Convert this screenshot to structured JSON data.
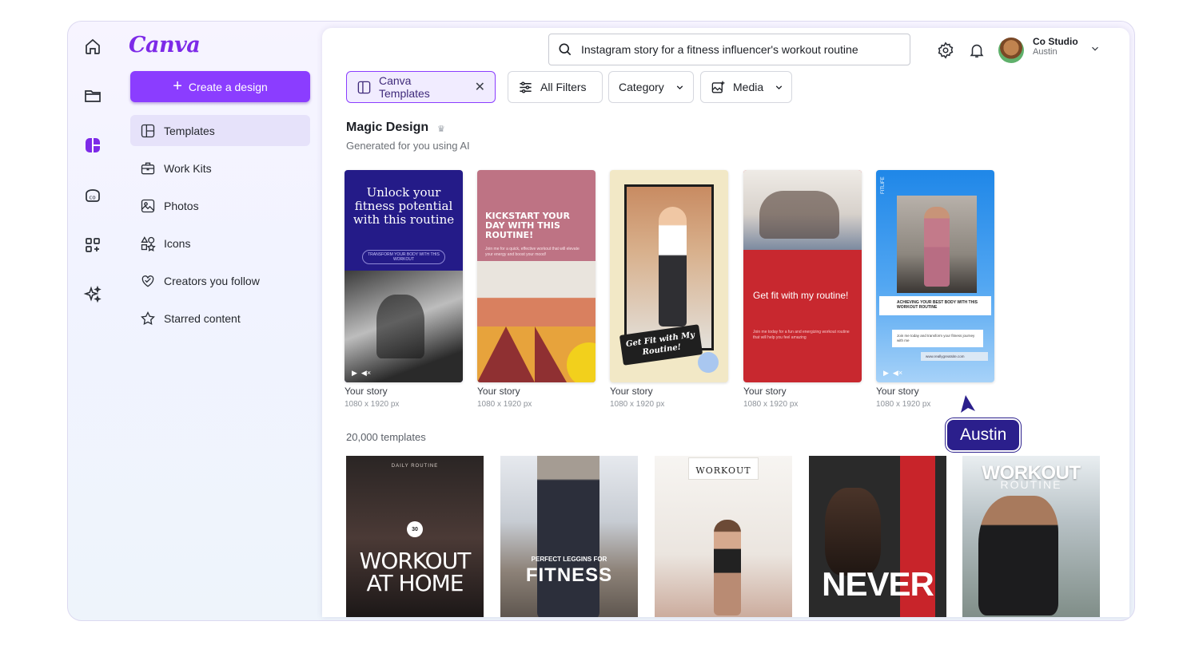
{
  "app": {
    "logo": "Canva"
  },
  "rail": {
    "items": [
      "home-icon",
      "folder-icon",
      "templates-icon",
      "brand-icon",
      "apps-icon",
      "magic-icon"
    ]
  },
  "sidebar": {
    "create_label": "Create a design",
    "items": [
      {
        "label": "Templates",
        "icon": "templates-icon",
        "active": true
      },
      {
        "label": "Work Kits",
        "icon": "briefcase-icon"
      },
      {
        "label": "Photos",
        "icon": "photo-icon"
      },
      {
        "label": "Icons",
        "icon": "shapes-icon"
      },
      {
        "label": "Creators you follow",
        "icon": "heart-icon"
      },
      {
        "label": "Starred content",
        "icon": "star-icon"
      }
    ]
  },
  "header": {
    "search_value": "Instagram story for a fitness influencer's workout routine",
    "user": {
      "name": "Co Studio",
      "sub": "Austin"
    }
  },
  "filters": {
    "selected": "Canva Templates",
    "all_filters": "All Filters",
    "category": "Category",
    "media": "Media"
  },
  "magic": {
    "title": "Magic Design",
    "subtitle": "Generated for you using AI",
    "cards": [
      {
        "caption": "Your story",
        "size": "1080 x 1920 px",
        "title": "Unlock your fitness potential with this routine",
        "tag": "TRANSFORM YOUR BODY WITH THIS WORKOUT"
      },
      {
        "caption": "Your story",
        "size": "1080 x 1920 px",
        "title": "KICKSTART YOUR DAY WITH THIS ROUTINE!",
        "sub": "Join me for a quick, effective workout that will elevate your energy and boost your mood!"
      },
      {
        "caption": "Your story",
        "size": "1080 x 1920 px",
        "title": "Get Fit with My Routine!"
      },
      {
        "caption": "Your story",
        "size": "1080 x 1920 px",
        "title": "Get fit with my routine!",
        "sub": "Join me today for a fun and energizing workout routine that will help you feel amazing"
      },
      {
        "caption": "Your story",
        "size": "1080 x 1920 px",
        "brand": "FITLIFE",
        "title": "ACHIEVING YOUR BEST BODY WITH THIS WORKOUT ROUTINE",
        "sub": "Join me today and transform your fitness journey with me",
        "url": "www.reallygreatsite.com"
      }
    ]
  },
  "collab": {
    "name": "Austin"
  },
  "templates": {
    "count": "20,000 templates",
    "items": [
      {
        "top": "DAILY ROUTINE",
        "minutes": "30",
        "title": "WORKOUT AT HOME"
      },
      {
        "kicker": "PERFECT LEGGINS FOR",
        "title": "FITNESS"
      },
      {
        "title": "WORKOUT"
      },
      {
        "title": "NEVER"
      },
      {
        "title": "WORKOUT",
        "sub": "ROUTINE"
      }
    ]
  }
}
